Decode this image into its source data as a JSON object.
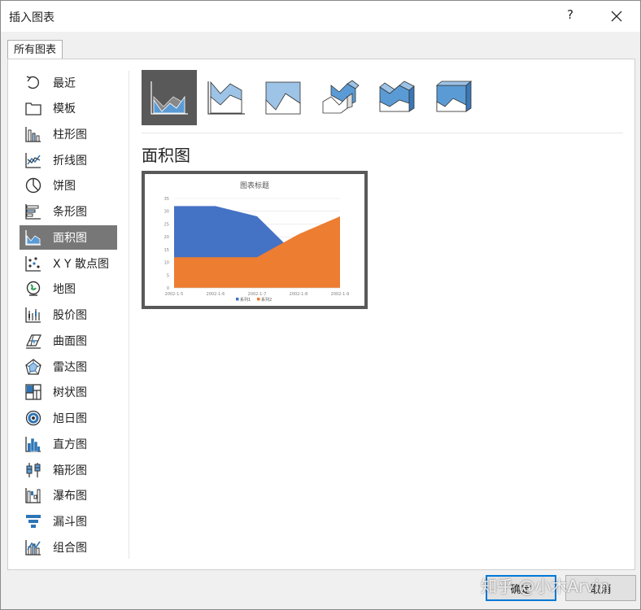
{
  "dialog": {
    "title": "插入图表",
    "help_label": "?"
  },
  "tab_label": "所有图表",
  "sidebar": {
    "selected_index": 6,
    "items": [
      {
        "label": "最近",
        "icon": "recent-icon"
      },
      {
        "label": "模板",
        "icon": "template-folder-icon"
      },
      {
        "label": "柱形图",
        "icon": "column-chart-icon"
      },
      {
        "label": "折线图",
        "icon": "line-chart-icon"
      },
      {
        "label": "饼图",
        "icon": "pie-chart-icon"
      },
      {
        "label": "条形图",
        "icon": "bar-chart-icon"
      },
      {
        "label": "面积图",
        "icon": "area-chart-icon"
      },
      {
        "label": "X Y 散点图",
        "icon": "scatter-chart-icon"
      },
      {
        "label": "地图",
        "icon": "map-chart-icon"
      },
      {
        "label": "股价图",
        "icon": "stock-chart-icon"
      },
      {
        "label": "曲面图",
        "icon": "surface-chart-icon"
      },
      {
        "label": "雷达图",
        "icon": "radar-chart-icon"
      },
      {
        "label": "树状图",
        "icon": "treemap-chart-icon"
      },
      {
        "label": "旭日图",
        "icon": "sunburst-chart-icon"
      },
      {
        "label": "直方图",
        "icon": "histogram-chart-icon"
      },
      {
        "label": "箱形图",
        "icon": "box-whisker-chart-icon"
      },
      {
        "label": "瀑布图",
        "icon": "waterfall-chart-icon"
      },
      {
        "label": "漏斗图",
        "icon": "funnel-chart-icon"
      },
      {
        "label": "组合图",
        "icon": "combo-chart-icon"
      }
    ]
  },
  "subtypes": {
    "selected_index": 0,
    "items": [
      "area-subtype-icon",
      "stacked-area-subtype-icon",
      "percent-stacked-area-subtype-icon",
      "3d-area-subtype-icon",
      "3d-stacked-area-subtype-icon",
      "3d-percent-stacked-area-subtype-icon"
    ]
  },
  "section_title": "面积图",
  "chart_data": {
    "type": "area",
    "title": "图表标题",
    "categories": [
      "2002-1-5",
      "2002-1-6",
      "2002-1-7",
      "2002-1-8",
      "2002-1-9"
    ],
    "series": [
      {
        "name": "系列1",
        "values": [
          32,
          32,
          28,
          12,
          15
        ],
        "color": "#4472c4"
      },
      {
        "name": "系列2",
        "values": [
          12,
          12,
          12,
          21,
          28
        ],
        "color": "#ed7d31"
      }
    ],
    "ylim": [
      0,
      35
    ],
    "yticks": [
      "0",
      "5",
      "10",
      "15",
      "20",
      "25",
      "30",
      "35"
    ],
    "grid": true,
    "legend": "bottom"
  },
  "buttons": {
    "ok": "确定",
    "cancel": "取消"
  },
  "watermark": "知乎 @小木Arvin"
}
